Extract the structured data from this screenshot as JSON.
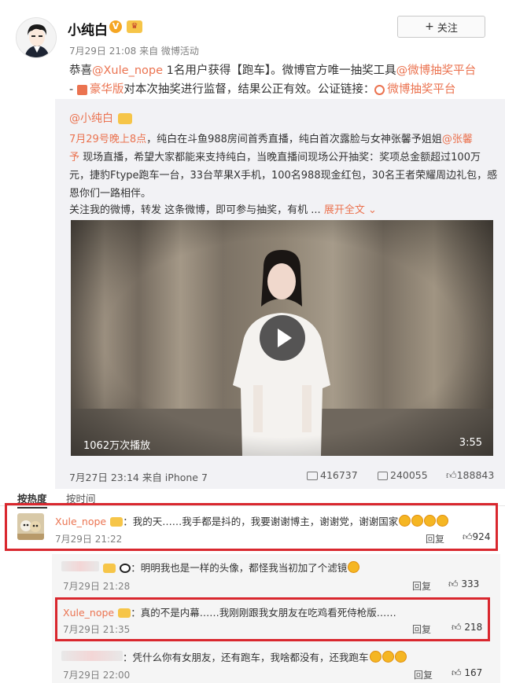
{
  "post": {
    "author": "小纯白",
    "follow_label": "关注",
    "meta": "7月29日 21:08 来自 微博活动",
    "line1_a": "恭喜",
    "line1_user": "@Xule_nope",
    "line1_b": " 1名用户获得【跑车】。微博官方唯一抽奖工具",
    "line1_link": "@微博抽奖平台",
    "line2_a": "- ",
    "line2_link1": "豪华版",
    "line2_b": "对本次抽奖进行监督，结果公正有效。公证链接：",
    "line2_link2": "微博抽奖平台"
  },
  "repost": {
    "author": "@小纯白",
    "line1_link": "7月29号晚上8点",
    "line1_b": "，纯白在斗鱼988房间首秀直播，纯白首次露脸与女神张馨予姐姐",
    "line1_link2": "@张馨",
    "line2_link": "予",
    "line2_b": " 现场直播，希望大家都能来支持纯白，当晚直播间现场公开抽奖：奖项总金额超过100万",
    "line3": "元，捷豹Ftype跑车一台，33台苹果X手机，100名988现金红包，30名王者荣耀周边礼包，感",
    "line4": "恩你们一路相伴。",
    "line5_a": "关注我的微博，转发 这条微博，即可参与抽奖，有机 ...",
    "line5_link": "展开全文",
    "video_views": "1062万次播放",
    "video_duration": "3:55",
    "meta": "7月27日 23:14 来自 iPhone 7",
    "reposts": "416737",
    "comments": "240055",
    "likes": "188843"
  },
  "tabs": {
    "hot": "按热度",
    "time": "按时间"
  },
  "comments": [
    {
      "user": "Xule_nope",
      "text": "：我的天……我手都是抖的，我要谢谢博主，谢谢党，谢谢国家",
      "time": "7月29日 21:22",
      "reply": "回复",
      "likes": "924"
    },
    {
      "user": "",
      "text": "：明明我也是一样的头像，都怪我当初加了个滤镜",
      "time": "7月29日 21:28",
      "reply": "回复",
      "likes": "333"
    },
    {
      "user": "Xule_nope",
      "text": "：真的不是内幕……我刚刚跟我女朋友在吃鸡看死侍枪版……",
      "time": "7月29日 21:35",
      "reply": "回复",
      "likes": "218"
    },
    {
      "user": "",
      "text": "：凭什么你有女朋友，还有跑车，我啥都没有，还我跑车",
      "time": "7月29日 22:00",
      "reply": "回复",
      "likes": "167"
    }
  ],
  "colors": {
    "link": "#eb7350",
    "highlight_border": "#d9272e",
    "repost_bg": "#f2f2f5"
  }
}
